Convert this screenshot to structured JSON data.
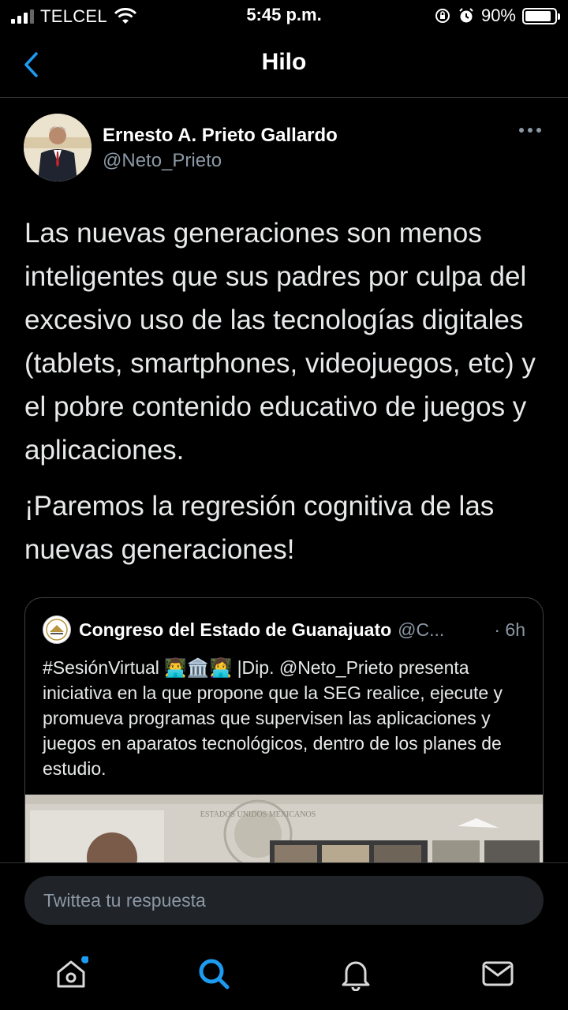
{
  "status_bar": {
    "carrier": "TELCEL",
    "time": "5:45 p.m.",
    "battery": "90%",
    "battery_level": 0.9
  },
  "header": {
    "title": "Hilo",
    "back_icon": "chevron-left-icon"
  },
  "tweet": {
    "author_name": "Ernesto A. Prieto Gallardo",
    "author_handle": "@Neto_Prieto",
    "paragraphs": [
      "Las nuevas generaciones son menos inteligentes que sus padres por culpa del excesivo uso de las tecnologías digitales (tablets, smartphones, videojuegos, etc) y el pobre contenido educativo de juegos y aplicaciones.",
      "¡Paremos la regresión cognitiva de las nuevas generaciones!"
    ]
  },
  "quote": {
    "author_name": "Congreso del Estado de Guanajuato",
    "author_handle": "@C...",
    "time": "· 6h",
    "text": "#SesiónVirtual 👨‍💻🏛️👩‍💻 |Dip. @Neto_Prieto presenta iniciativa en la que propone que la SEG realice, ejecute y promueva programas que supervisen las aplicaciones y juegos en aparatos tecnológicos, dentro de los planes de estudio.",
    "media_text": "ESTADOS UNIDOS MEXICANOS"
  },
  "reply": {
    "placeholder": "Twittea tu respuesta"
  },
  "tabs": [
    {
      "name": "home-icon",
      "has_dot": true
    },
    {
      "name": "search-icon",
      "active": true
    },
    {
      "name": "bell-icon"
    },
    {
      "name": "mail-icon"
    }
  ],
  "colors": {
    "accent": "#1d9bf0",
    "background": "#000000",
    "secondary_text": "#8b98a5"
  }
}
